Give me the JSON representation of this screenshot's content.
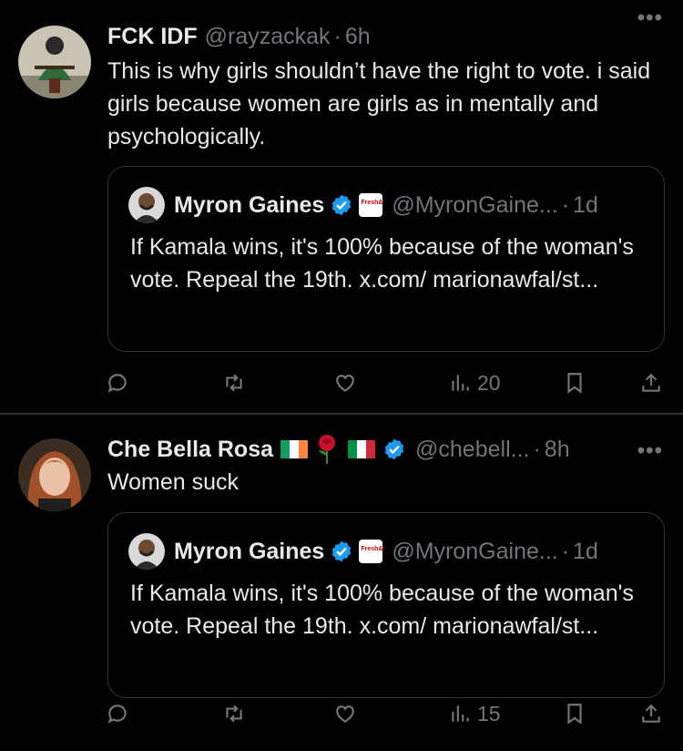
{
  "tweets": [
    {
      "name": "FCK IDF",
      "handle": "@rayzackak",
      "dot": "·",
      "time": "6h",
      "more": "•••",
      "text": "This is why girls shouldn’t have the right to vote. i said girls because women are girls as in mentally and psychologically.",
      "quote": {
        "name": "Myron Gaines",
        "handle": "@MyronGaine...",
        "dot": "·",
        "time": "1d",
        "text": "If Kamala wins, it's 100% because of the woman's vote. Repeal the 19th. x.com/ marionawfal/st..."
      },
      "views": "20"
    },
    {
      "name": "Che Bella Rosa",
      "handle": "@chebell...",
      "dot": "·",
      "time": "8h",
      "more": "•••",
      "text": "Women suck",
      "quote": {
        "name": "Myron Gaines",
        "handle": "@MyronGaine...",
        "dot": "·",
        "time": "1d",
        "text": "If Kamala wins, it's 100% because of the woman's vote. Repeal the 19th. x.com/ marionawfal/st..."
      },
      "views": "15"
    }
  ],
  "colors": {
    "background": "#000000",
    "text": "#e7e9ea",
    "muted": "#71767b",
    "verified": "#1d9bf0",
    "border": "#2f3336"
  },
  "icons": [
    "reply-icon",
    "retweet-icon",
    "like-icon",
    "views-icon",
    "bookmark-icon",
    "share-icon",
    "verified-icon",
    "more-icon"
  ]
}
